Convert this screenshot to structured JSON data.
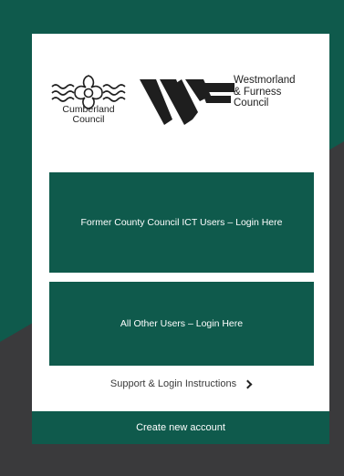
{
  "colors": {
    "brand_green": "#0f5a4c",
    "dark_grey": "#3a3a3c",
    "card_white": "#ffffff"
  },
  "logos": {
    "cumberland": {
      "line1": "Cumberland",
      "line2": "Council",
      "icon": "flower-wave-icon"
    },
    "westmorland": {
      "line1": "Westmorland",
      "line2": "& Furness",
      "line3": "Council",
      "icon": "wf-chevron-logo-icon"
    }
  },
  "buttons": {
    "ict_login": "Former County Council ICT Users – Login Here",
    "other_login": "All Other Users – Login Here"
  },
  "support": {
    "label": "Support & Login Instructions",
    "icon": "chevron-right-icon"
  },
  "footer": {
    "create_account": "Create new account"
  }
}
